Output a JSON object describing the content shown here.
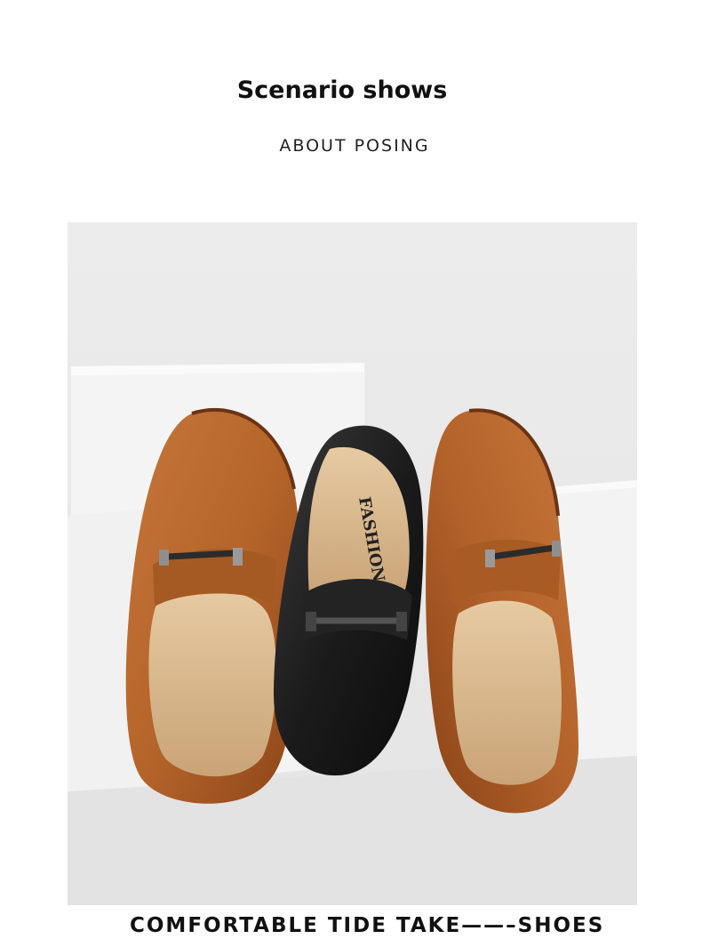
{
  "header": {
    "title": "Scenario shows",
    "subtitle": "ABOUT POSING"
  },
  "photo": {
    "shoe_text": "FASHION",
    "colors": {
      "tan_leather": "#b5652a",
      "black_leather": "#1a1a1a",
      "backdrop": "#e9e9e9"
    }
  },
  "footer": {
    "tagline": "COMFORTABLE TIDE TAKE——–SHOES"
  }
}
